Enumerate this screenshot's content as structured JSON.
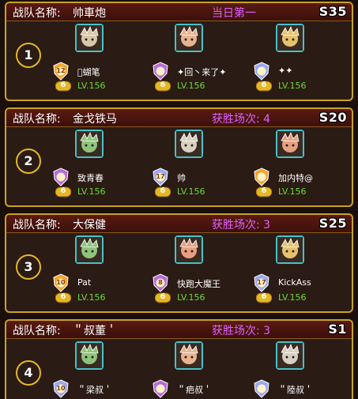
{
  "colors": {
    "card_border": "#c9a227",
    "header_bg": "#5a1a12",
    "status_text": "#e060ff",
    "level_text": "#6fd93a",
    "avatar_border": "#49c1c8"
  },
  "label": "战队名称:",
  "teams": [
    {
      "rank": "1",
      "name": "帅車炮",
      "status": "当日第一",
      "season": "S35",
      "members": [
        {
          "name": "\u0000蝴笔",
          "lv": "LV.156",
          "star": "6",
          "badge_num": "12",
          "badge_color": "#f2a531",
          "avatar_color": "#d8c7a8"
        },
        {
          "name": "✦回丶来了✦",
          "lv": "LV.156",
          "star": "6",
          "badge_num": "",
          "badge_color": "#b86ad6",
          "avatar_color": "#e8b38f"
        },
        {
          "name": "✦✦",
          "lv": "LV.156",
          "star": "6",
          "badge_num": "",
          "badge_color": "#9aa8f0",
          "avatar_color": "#e6c36a"
        }
      ]
    },
    {
      "rank": "2",
      "name": "金戈铁马",
      "status": "获胜场次: 4",
      "season": "S20",
      "members": [
        {
          "name": "致青春",
          "lv": "LV.156",
          "star": "6",
          "badge_num": "",
          "badge_color": "#b86ad6",
          "avatar_color": "#8fc47a"
        },
        {
          "name": "帅",
          "lv": "LV.156",
          "star": "6",
          "badge_num": "17",
          "badge_color": "#9aa8f0",
          "avatar_color": "#d8d0c0"
        },
        {
          "name": "加内特@",
          "lv": "LV.156",
          "star": "6",
          "badge_num": "",
          "badge_color": "#f2a531",
          "avatar_color": "#e8a080"
        }
      ]
    },
    {
      "rank": "3",
      "name": "大保健",
      "status": "获胜场次: 3",
      "season": "S25",
      "members": [
        {
          "name": "Pat",
          "lv": "LV.156",
          "star": "6",
          "badge_num": "10",
          "badge_color": "#f2a531",
          "avatar_color": "#8fc47a"
        },
        {
          "name": "快跑大魔王",
          "lv": "LV.156",
          "star": "6",
          "badge_num": "8",
          "badge_color": "#b86ad6",
          "avatar_color": "#e8a080"
        },
        {
          "name": "KickAss",
          "lv": "LV.156",
          "star": "6",
          "badge_num": "17",
          "badge_color": "#9aa8f0",
          "avatar_color": "#e6c36a"
        }
      ]
    },
    {
      "rank": "4",
      "name": "＂叔董＇",
      "status": "获胜场次: 3",
      "season": "S1",
      "members": [
        {
          "name": "＂梁叔＇",
          "lv": "",
          "star": "",
          "badge_num": "10",
          "badge_color": "#9aa8f0",
          "avatar_color": "#8fc47a"
        },
        {
          "name": "＂疤叔＇",
          "lv": "",
          "star": "",
          "badge_num": "",
          "badge_color": "#b86ad6",
          "avatar_color": "#e8b38f"
        },
        {
          "name": "＂陸叔＇",
          "lv": "",
          "star": "",
          "badge_num": "",
          "badge_color": "#9aa8f0",
          "avatar_color": "#d8d0c0"
        }
      ]
    }
  ]
}
